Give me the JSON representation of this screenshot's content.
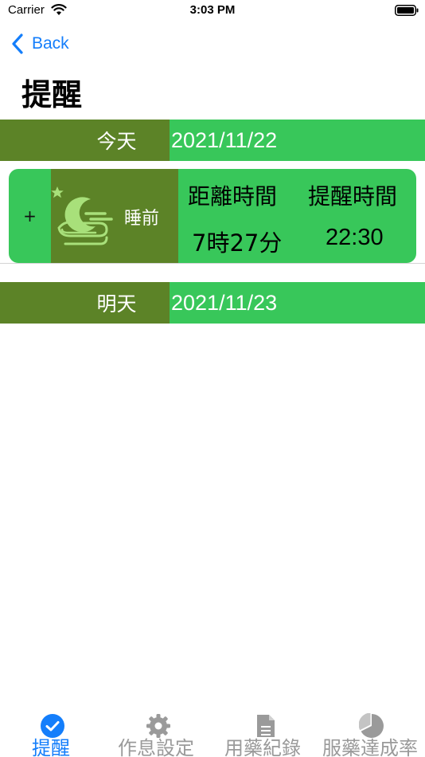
{
  "status_bar": {
    "carrier": "Carrier",
    "time": "3:03 PM"
  },
  "nav": {
    "back_label": "Back"
  },
  "page_title": "提醒",
  "days": {
    "today": {
      "label": "今天",
      "date": "2021/11/22"
    },
    "tomorrow": {
      "label": "明天",
      "date": "2021/11/23"
    }
  },
  "reminder": {
    "add_label": "+",
    "slot_label": "睡前",
    "slot_icon": "moon-icon",
    "distance_header": "距離時間",
    "time_header": "提醒時間",
    "distance_value": "7時27分",
    "time_value": "22:30"
  },
  "tabs": [
    {
      "label": "提醒",
      "icon": "checkmark-circle-icon",
      "active": true
    },
    {
      "label": "作息設定",
      "icon": "gear-icon",
      "active": false
    },
    {
      "label": "用藥紀錄",
      "icon": "document-icon",
      "active": false
    },
    {
      "label": "服藥達成率",
      "icon": "pie-chart-icon",
      "active": false
    }
  ],
  "colors": {
    "accent_blue": "#147efb",
    "dark_green": "#5c8327",
    "bright_green": "#38c75a",
    "icon_green": "#a8e07a",
    "tab_gray": "#9a9a9a"
  }
}
